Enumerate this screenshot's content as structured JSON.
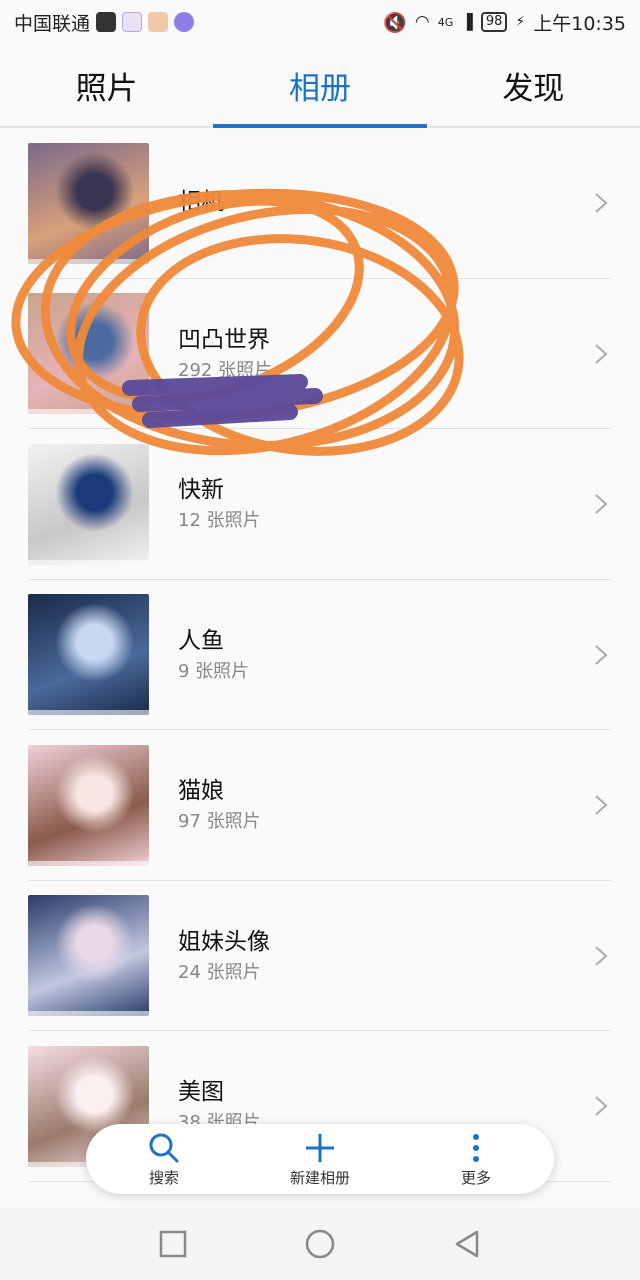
{
  "status": {
    "carrier": "中国联通",
    "network": "4G",
    "battery": "98",
    "time": "上午10:35"
  },
  "tabs": [
    {
      "label": "照片"
    },
    {
      "label": "相册"
    },
    {
      "label": "发现"
    }
  ],
  "albums": [
    {
      "name": "相机",
      "count": "",
      "colors": [
        "#7a6a8a",
        "#d9a07a",
        "#3a3550"
      ]
    },
    {
      "name": "凹凸世界",
      "count": "292 张照片",
      "colors": [
        "#c9a48e",
        "#e6b3b8",
        "#4a6aa0"
      ]
    },
    {
      "name": "快新",
      "count": "12 张照片",
      "colors": [
        "#f2f2f2",
        "#c8c8c8",
        "#1b3a7a"
      ]
    },
    {
      "name": "人鱼",
      "count": "9 张照片",
      "colors": [
        "#1a2a4a",
        "#4a6a9a",
        "#c8d8f0"
      ]
    },
    {
      "name": "猫娘",
      "count": "97 张照片",
      "colors": [
        "#f0d0d8",
        "#8a5a4a",
        "#f7e6e0"
      ]
    },
    {
      "name": "姐妹头像",
      "count": "24 张照片",
      "colors": [
        "#2a3a6a",
        "#c0c8e0",
        "#e8d8e8"
      ]
    },
    {
      "name": "美图",
      "count": "38 张照片",
      "colors": [
        "#f6dde2",
        "#9a7a6a",
        "#fbeff0"
      ]
    }
  ],
  "actions": {
    "search": "搜索",
    "new_album": "新建相册",
    "more": "更多"
  },
  "accent_color": "#1a73c8",
  "scribble_color": "#f08a3a",
  "redact_color": "#5a4a9a"
}
